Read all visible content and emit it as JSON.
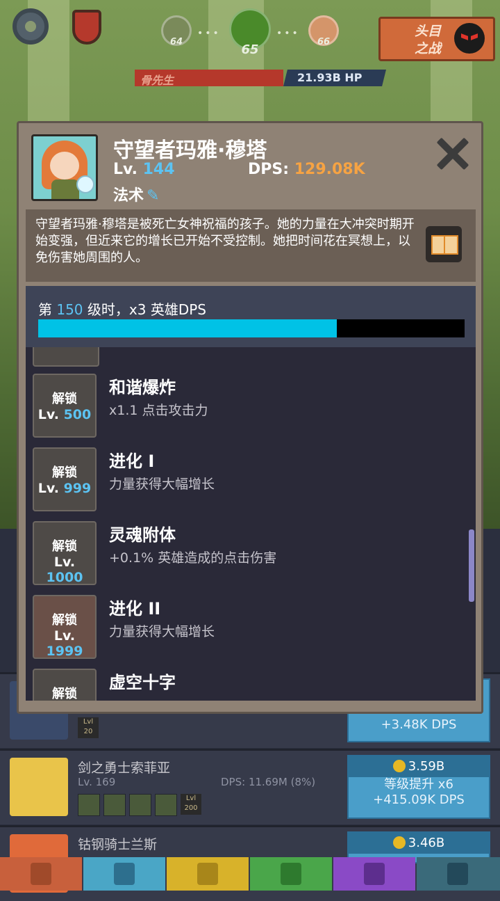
{
  "hud": {
    "stages": [
      "64",
      "65",
      "66"
    ],
    "boss_fight_label": "头目\n之战",
    "boss_name": "骨先生",
    "boss_hp": "21.93B HP"
  },
  "hero": {
    "name": "守望者玛雅·穆塔",
    "lv_label": "Lv.",
    "lv_value": "144",
    "dps_label": "DPS:",
    "dps_value": "129.08K",
    "type": "法术",
    "description": "守望者玛雅·穆塔是被死亡女神祝福的孩子。她的力量在大冲突时期开始变强，但近来它的增长已开始不受控制。她把时间花在冥想上，以免伤害她周围的人。"
  },
  "milestone": {
    "prefix": "第",
    "level": "150",
    "suffix": "级时，x3 英雄DPS",
    "progress": 0.7
  },
  "skills": [
    {
      "lock": "解锁",
      "lv_label": "Lv.",
      "lv": "500",
      "name": "和谐爆炸",
      "desc": "x1.1 点击攻击力"
    },
    {
      "lock": "解锁",
      "lv_label": "Lv.",
      "lv": "999",
      "name": "进化 I",
      "desc": "力量获得大幅增长"
    },
    {
      "lock": "解锁",
      "lv_label": "Lv.",
      "lv": "1000",
      "name": "灵魂附体",
      "desc": "+0.1% 英雄造成的点击伤害"
    },
    {
      "lock": "解锁",
      "lv_label": "Lv.",
      "lv": "1999",
      "name": "进化 II",
      "desc": "力量获得大幅增长"
    },
    {
      "lock": "解锁",
      "lv_label": "",
      "lv": "",
      "name": "虚空十字",
      "desc": ""
    }
  ],
  "behind_rows": [
    {
      "lvl_badge": "Lvl 20",
      "upgrade": "+3.48K DPS"
    },
    {
      "name": "剑之勇士索菲亚",
      "lv": "Lv. 169",
      "dps": "DPS: 11.69M (8%)",
      "cost": "3.59B",
      "upgrade": "等级提升 x6\n+415.09K DPS",
      "lvl_badge": "Lvl 200"
    },
    {
      "name": "钴钢骑士兰斯",
      "cost": "3.46B"
    }
  ],
  "colors": {
    "accent": "#5cc3f2",
    "dps": "#f6a343",
    "progress": "#00c2e6"
  },
  "tabs": [
    "sword-icon",
    "helmet-icon",
    "shirt-icon",
    "pet-icon",
    "heart-icon",
    "star-icon"
  ]
}
